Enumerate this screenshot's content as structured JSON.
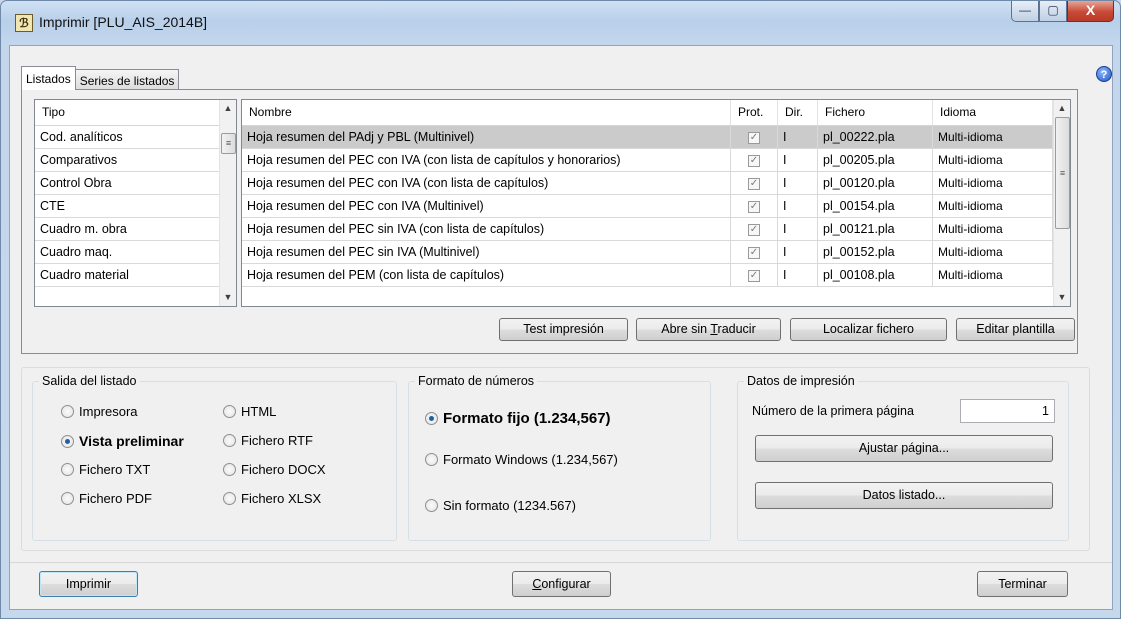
{
  "window": {
    "title": "Imprimir [PLU_AIS_2014B]",
    "controls": {
      "minimize": "—",
      "maximize": "▢",
      "close": "X"
    }
  },
  "tabs": [
    {
      "label": "Listados",
      "active": true
    },
    {
      "label": "Series de listados",
      "active": false
    }
  ],
  "tipo_list": {
    "header": "Tipo",
    "items": [
      "Cod. analíticos",
      "Comparativos",
      "Control Obra",
      "CTE",
      "Cuadro m. obra",
      "Cuadro maq.",
      "Cuadro material"
    ]
  },
  "reports": {
    "headers": [
      "Nombre",
      "Prot.",
      "Dir.",
      "Fichero",
      "Idioma"
    ],
    "rows": [
      {
        "nombre": "Hoja resumen del PAdj y PBL (Multinivel)",
        "prot": true,
        "dir": "I",
        "fichero": "pl_00222.pla",
        "idioma": "Multi-idioma",
        "selected": true
      },
      {
        "nombre": "Hoja resumen del PEC con IVA (con lista de capítulos y honorarios)",
        "prot": true,
        "dir": "I",
        "fichero": "pl_00205.pla",
        "idioma": "Multi-idioma",
        "selected": false
      },
      {
        "nombre": "Hoja resumen del PEC con IVA (con lista de capítulos)",
        "prot": true,
        "dir": "I",
        "fichero": "pl_00120.pla",
        "idioma": "Multi-idioma",
        "selected": false
      },
      {
        "nombre": "Hoja resumen del PEC con IVA (Multinivel)",
        "prot": true,
        "dir": "I",
        "fichero": "pl_00154.pla",
        "idioma": "Multi-idioma",
        "selected": false
      },
      {
        "nombre": "Hoja resumen del PEC sin IVA (con lista de capítulos)",
        "prot": true,
        "dir": "I",
        "fichero": "pl_00121.pla",
        "idioma": "Multi-idioma",
        "selected": false
      },
      {
        "nombre": "Hoja resumen del PEC sin IVA (Multinivel)",
        "prot": true,
        "dir": "I",
        "fichero": "pl_00152.pla",
        "idioma": "Multi-idioma",
        "selected": false
      },
      {
        "nombre": "Hoja resumen del PEM (con lista de capítulos)",
        "prot": true,
        "dir": "I",
        "fichero": "pl_00108.pla",
        "idioma": "Multi-idioma",
        "selected": false
      }
    ]
  },
  "list_buttons": {
    "test": "Test impresión",
    "abre_prefix": "Abre sin ",
    "abre_accel": "T",
    "abre_suffix": "raducir",
    "localizar": "Localizar fichero",
    "editar": "Editar plantilla"
  },
  "salida": {
    "legend": "Salida del listado",
    "options": [
      {
        "label": "Impresora",
        "checked": false
      },
      {
        "label": "HTML",
        "checked": false
      },
      {
        "label": "Vista preliminar",
        "checked": true
      },
      {
        "label": "Fichero RTF",
        "checked": false
      },
      {
        "label": "Fichero TXT",
        "checked": false
      },
      {
        "label": "Fichero DOCX",
        "checked": false
      },
      {
        "label": "Fichero PDF",
        "checked": false
      },
      {
        "label": "Fichero XLSX",
        "checked": false
      }
    ]
  },
  "formato": {
    "legend": "Formato de números",
    "options": [
      {
        "label": "Formato fijo (1.234,567)",
        "checked": true
      },
      {
        "label": "Formato Windows (1.234,567)",
        "checked": false
      },
      {
        "label": "Sin formato (1234.567)",
        "checked": false
      }
    ]
  },
  "datos": {
    "legend": "Datos de impresión",
    "first_page_label": "Número de la primera página",
    "first_page_value": "1",
    "ajustar": "Ajustar página...",
    "datos_listado": "Datos listado..."
  },
  "footer": {
    "imprimir": "Imprimir",
    "configurar_accel": "C",
    "configurar_rest": "onfigurar",
    "terminar": "Terminar"
  }
}
